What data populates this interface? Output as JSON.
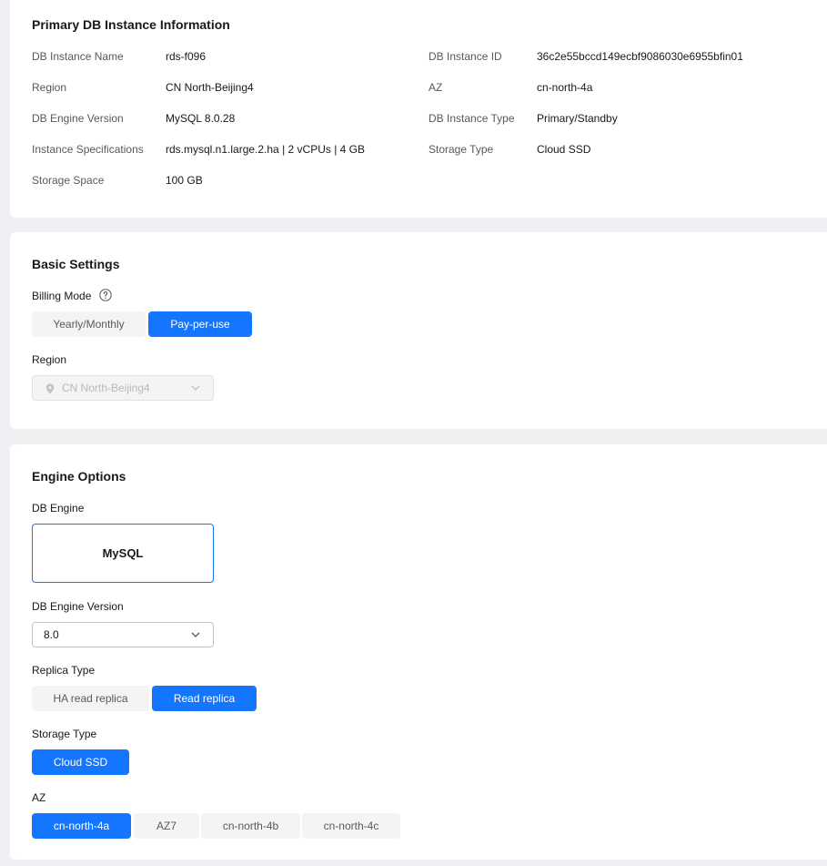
{
  "primary": {
    "title": "Primary DB Instance Information",
    "fields": [
      {
        "label": "DB Instance Name",
        "value": "rds-f096"
      },
      {
        "label": "DB Instance ID",
        "value": "36c2e55bccd149ecbf9086030e6955bfin01"
      },
      {
        "label": "Region",
        "value": "CN North-Beijing4"
      },
      {
        "label": "AZ",
        "value": "cn-north-4a"
      },
      {
        "label": "DB Engine Version",
        "value": "MySQL 8.0.28"
      },
      {
        "label": "DB Instance Type",
        "value": "Primary/Standby"
      },
      {
        "label": "Instance Specifications",
        "value": "rds.mysql.n1.large.2.ha | 2 vCPUs | 4 GB"
      },
      {
        "label": "Storage Type",
        "value": "Cloud SSD"
      },
      {
        "label": "Storage Space",
        "value": "100 GB"
      }
    ]
  },
  "basic": {
    "title": "Basic Settings",
    "billing_label": "Billing Mode",
    "billing_options": [
      "Yearly/Monthly",
      "Pay-per-use"
    ],
    "billing_selected": "Pay-per-use",
    "region_label": "Region",
    "region_value": "CN North-Beijing4"
  },
  "engine": {
    "title": "Engine Options",
    "engine_label": "DB Engine",
    "engine_value": "MySQL",
    "version_label": "DB Engine Version",
    "version_value": "8.0",
    "replica_label": "Replica Type",
    "replica_options": [
      "HA read replica",
      "Read replica"
    ],
    "replica_selected": "Read replica",
    "storage_label": "Storage Type",
    "storage_options": [
      "Cloud SSD"
    ],
    "storage_selected": "Cloud SSD",
    "az_label": "AZ",
    "az_options": [
      "cn-north-4a",
      "AZ7",
      "cn-north-4b",
      "cn-north-4c"
    ],
    "az_selected": "cn-north-4a"
  },
  "colors": {
    "accent": "#1476ff",
    "page_bg": "#eef0f4",
    "card_bg": "#ffffff"
  },
  "icons": {
    "help": "question-circle-icon",
    "location": "map-pin-icon",
    "dropdown": "chevron-down-icon"
  }
}
